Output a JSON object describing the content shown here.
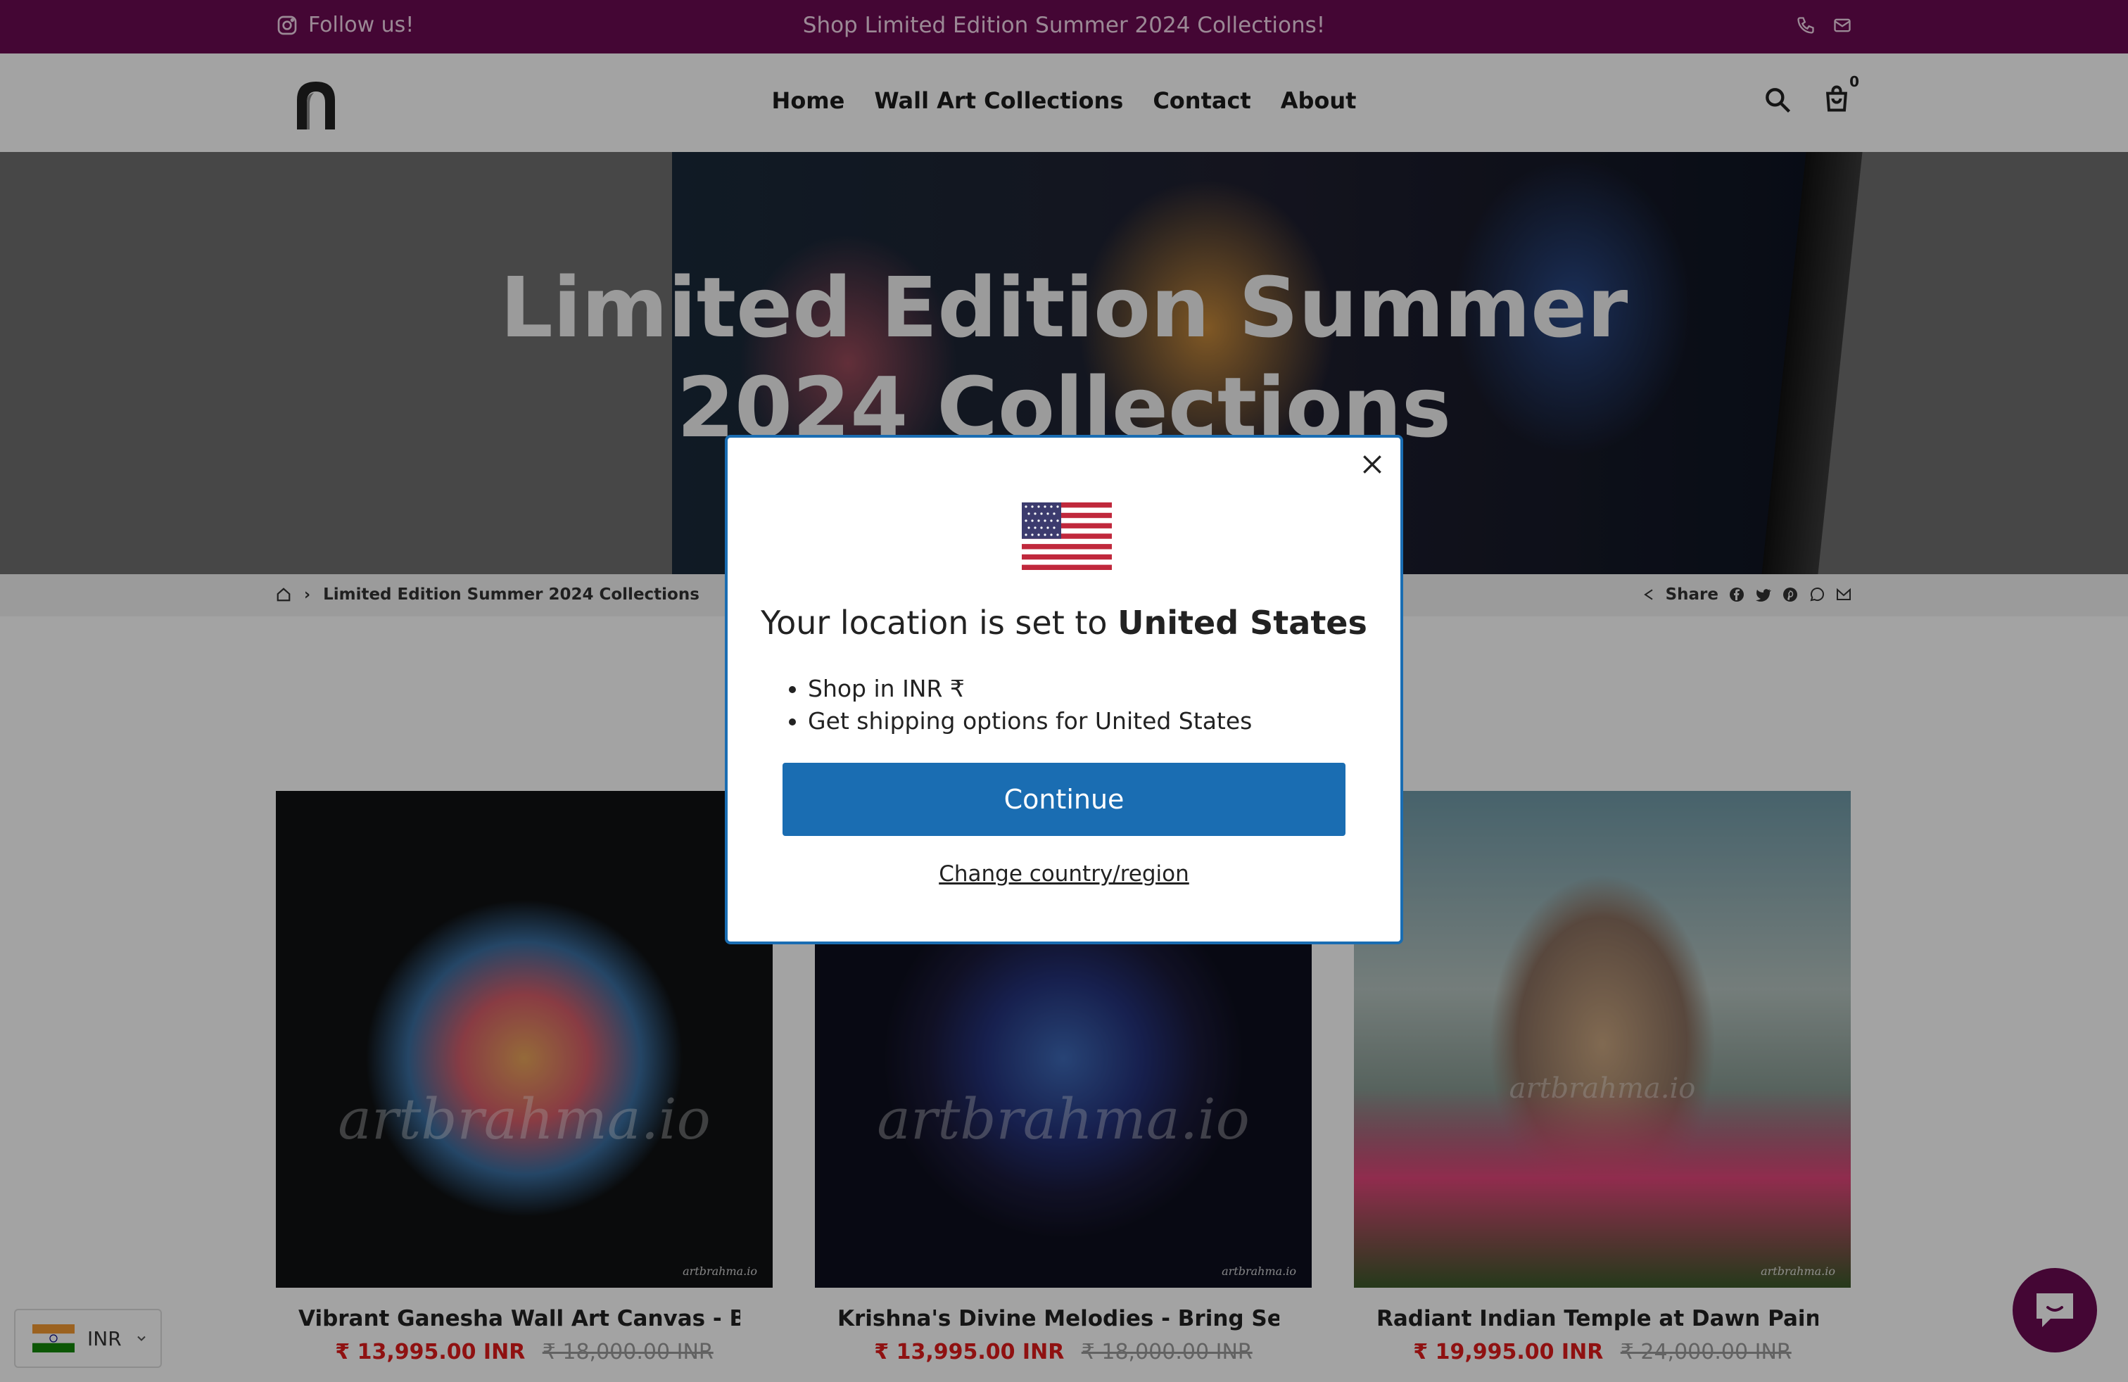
{
  "announcement": {
    "follow": "Follow us!",
    "message": "Shop Limited Edition Summer 2024 Collections!"
  },
  "nav": {
    "items": [
      "Home",
      "Wall Art Collections",
      "Contact",
      "About"
    ],
    "cart_count": "0"
  },
  "hero": {
    "title_line1": "Limited Edition Summer",
    "title_line2": "2024 Collections"
  },
  "breadcrumb": {
    "current": "Limited Edition Summer 2024 Collections",
    "share_label": "Share"
  },
  "products": [
    {
      "title": "Vibrant Ganesha Wall Art Canvas - B...",
      "sale_price": "₹ 13,995.00 INR",
      "regular_price": "₹ 18,000.00 INR",
      "watermark": "artbrahma.io",
      "corner_mark": "artbrahma.io"
    },
    {
      "title": "Krishna's Divine Melodies - Bring Ser...",
      "sale_price": "₹ 13,995.00 INR",
      "regular_price": "₹ 18,000.00 INR",
      "watermark": "artbrahma.io",
      "corner_mark": "artbrahma.io"
    },
    {
      "title": "Radiant Indian Temple at Dawn Paint...",
      "sale_price": "₹ 19,995.00 INR",
      "regular_price": "₹ 24,000.00 INR",
      "watermark": "artbrahma.io",
      "corner_mark": "artbrahma.io"
    }
  ],
  "currency_selector": {
    "value": "INR"
  },
  "modal": {
    "location_prefix": "Your location is set to",
    "country": "United States",
    "bullets": [
      "Shop in INR ₹",
      "Get shipping options for United States"
    ],
    "continue_label": "Continue",
    "change_label": "Change country/region"
  },
  "colors": {
    "announcement_bg": "#6b0a52",
    "accent_blue": "#1a6db2",
    "sale_red": "#e01b1b"
  },
  "icons": [
    "instagram-icon",
    "phone-icon",
    "mail-icon",
    "search-icon",
    "cart-icon",
    "home-icon",
    "share-icon",
    "facebook-icon",
    "twitter-icon",
    "pinterest-icon",
    "whatsapp-icon",
    "close-icon",
    "us-flag-icon",
    "india-flag-icon",
    "chevron-down-icon",
    "chat-icon"
  ]
}
